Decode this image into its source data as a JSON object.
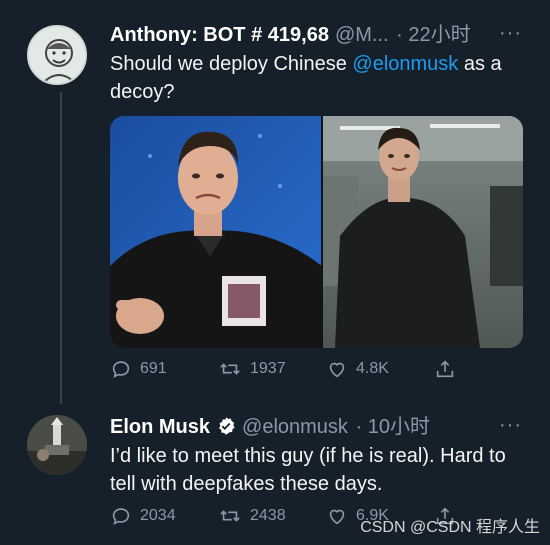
{
  "tweet1": {
    "name": "Anthony: BOT # 419,68",
    "handle": "@M...",
    "time": "· 22小时",
    "more": "···",
    "text_before": "Should we deploy Chinese ",
    "mention": "@elonmusk",
    "text_after": " as a decoy?",
    "replies": "691",
    "retweets": "1937",
    "likes": "4.8K"
  },
  "tweet2": {
    "name": "Elon Musk",
    "handle": "@elonmusk",
    "time": "· 10小时",
    "more": "···",
    "text": "I’d like to meet this guy (if he is real). Hard to tell with deepfakes these days.",
    "replies": "2034",
    "retweets": "2438",
    "likes": "6.9K"
  },
  "watermark": "CSDN @CSDN 程序人生",
  "colors": {
    "background": "#15202b",
    "accent": "#1d9bf0",
    "muted": "#8b98a5",
    "thread_line": "#38444d"
  },
  "icons": [
    "reply-icon",
    "retweet-icon",
    "like-icon",
    "share-icon",
    "verified-badge-icon",
    "more-icon"
  ]
}
